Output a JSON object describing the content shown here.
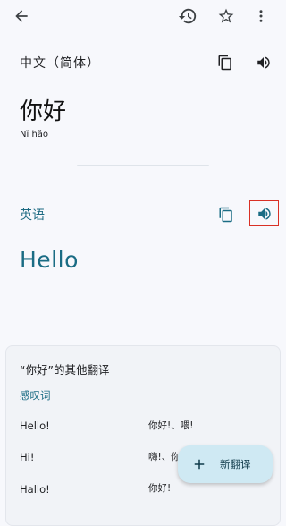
{
  "topbar": {
    "back_icon": "arrow-back-icon",
    "history_icon": "history-icon",
    "star_icon": "star-outline-icon",
    "more_icon": "more-vert-icon"
  },
  "source": {
    "language": "中文（简体）",
    "text": "你好",
    "transliteration": "Nǐ hǎo"
  },
  "target": {
    "language": "英语",
    "text": "Hello"
  },
  "other_translations": {
    "title": "“你好”的其他翻译",
    "part_of_speech": "感叹词",
    "rows": [
      {
        "en": "Hello!",
        "zh": "你好!、喂!"
      },
      {
        "en": "Hi!",
        "zh": "嗨!、你好!"
      },
      {
        "en": "Hallo!",
        "zh": "你好!"
      }
    ]
  },
  "fab": {
    "label": "新翻译",
    "icon": "plus-icon"
  },
  "colors": {
    "accent": "#1a6c84",
    "fab_bg": "#cfe9f3",
    "highlight_border": "#d93025",
    "background": "#f7f8fc"
  }
}
